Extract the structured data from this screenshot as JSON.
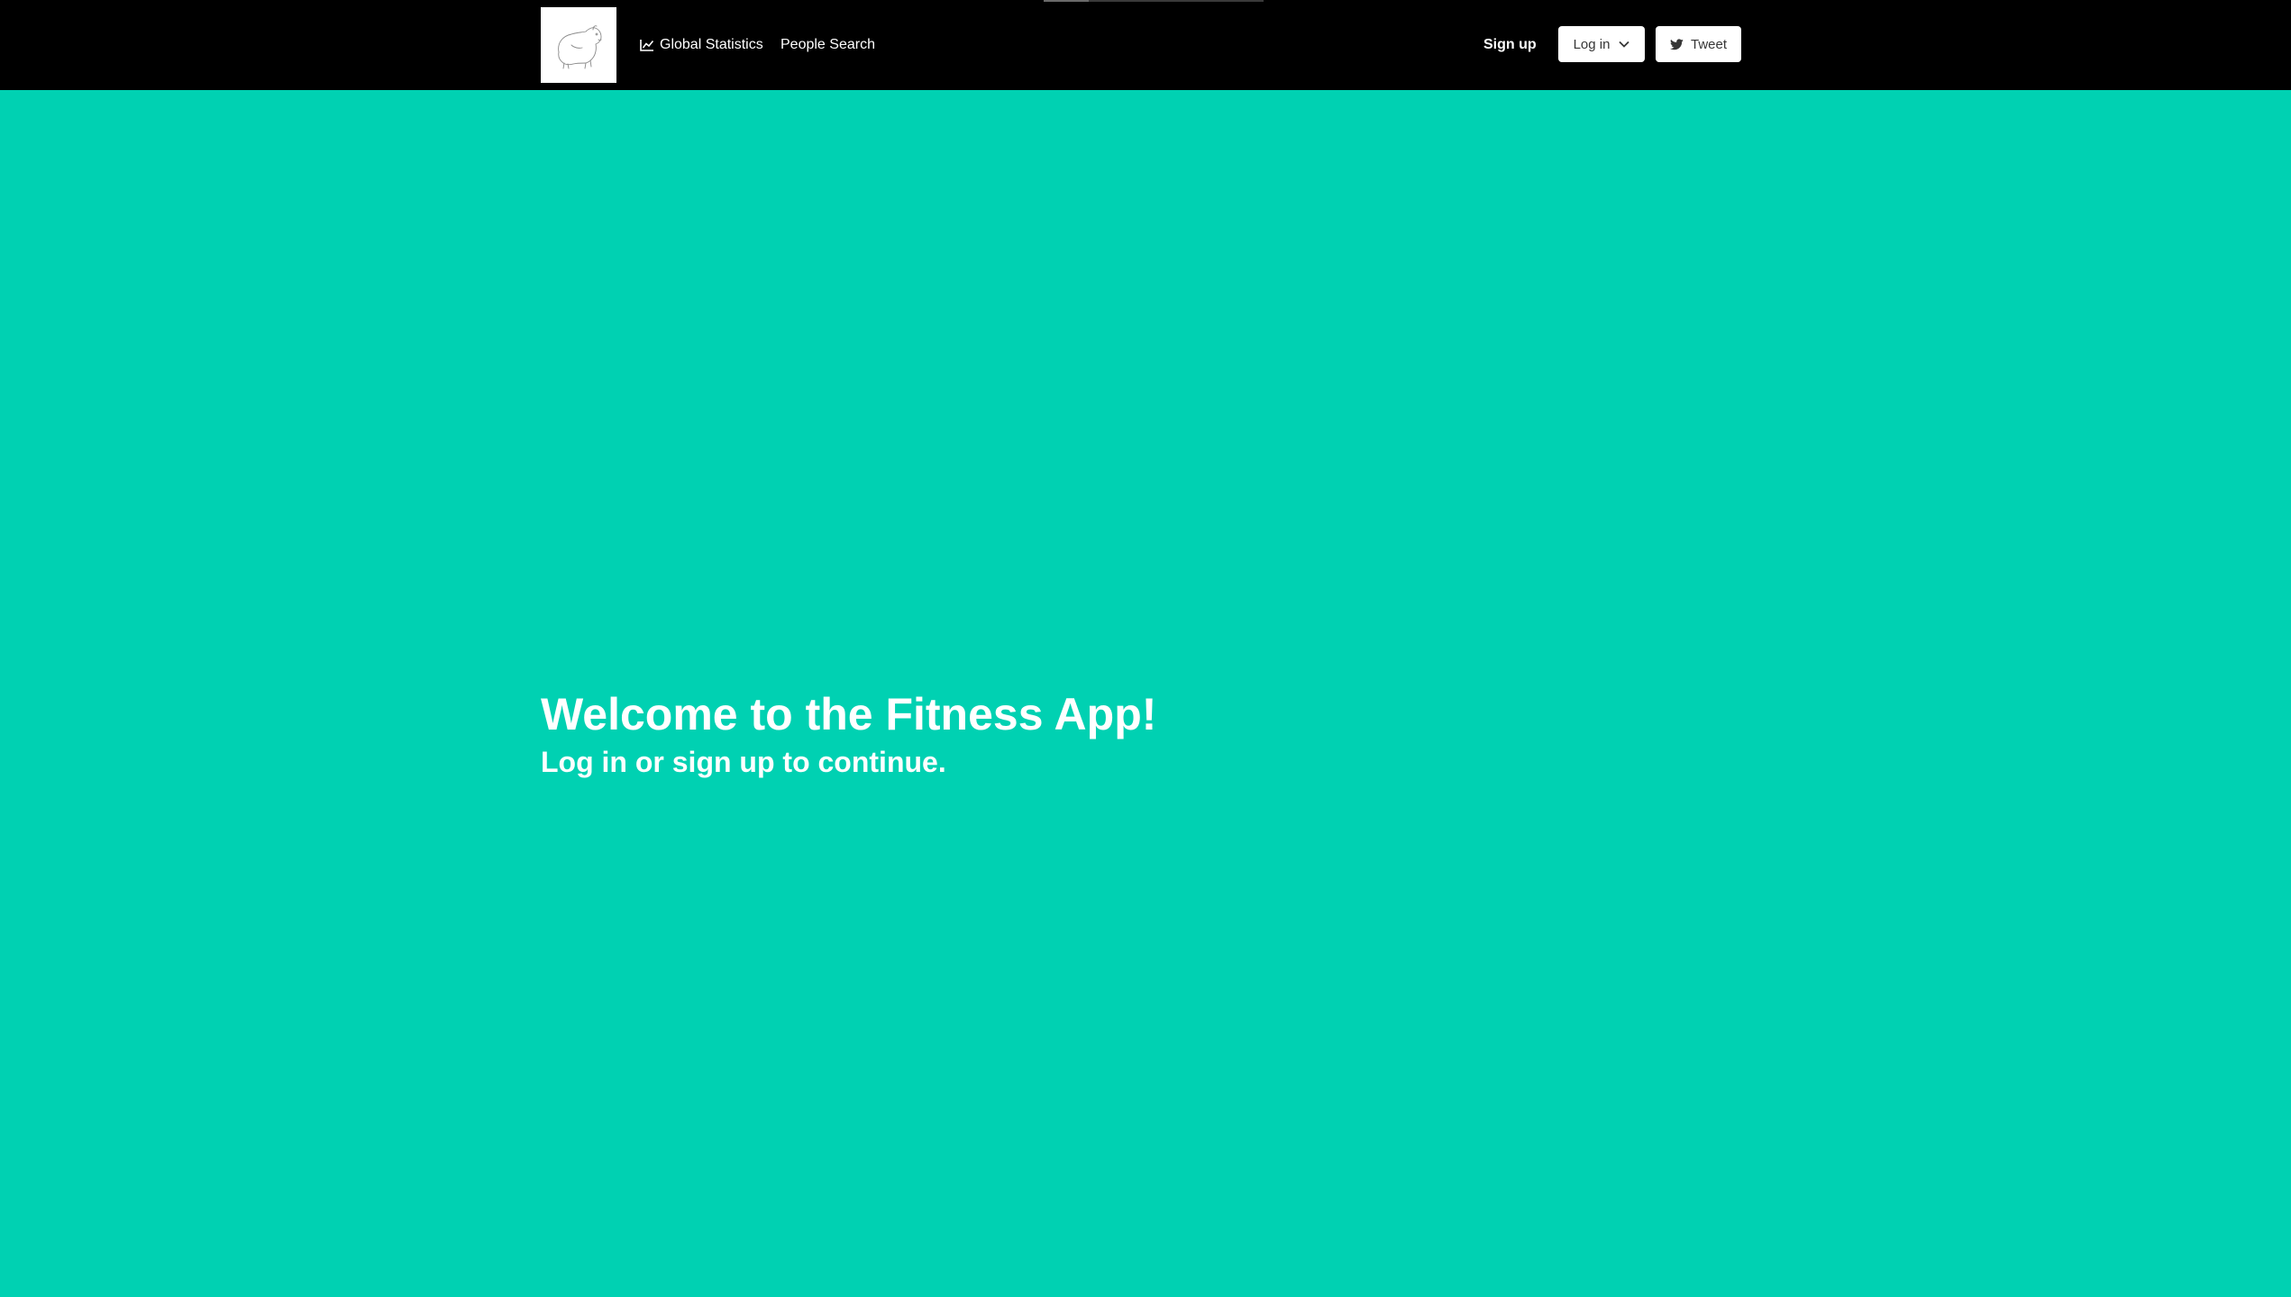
{
  "navbar": {
    "logo_alt": "Capybara sketch logo",
    "links": [
      {
        "label": "Global Statistics",
        "icon": "line-chart-icon"
      },
      {
        "label": "People Search"
      }
    ],
    "signup_label": "Sign up",
    "login_label": "Log in",
    "login_icon": "chevron-down-icon",
    "tweet_label": "Tweet",
    "tweet_icon": "twitter-icon"
  },
  "hero": {
    "title": "Welcome to the Fitness App!",
    "subtitle": "Log in or sign up to continue."
  },
  "colors": {
    "navbar_bg": "#000000",
    "hero_bg": "#00d1b2",
    "text": "#ffffff",
    "button_bg": "#ffffff",
    "button_text": "#363636"
  }
}
